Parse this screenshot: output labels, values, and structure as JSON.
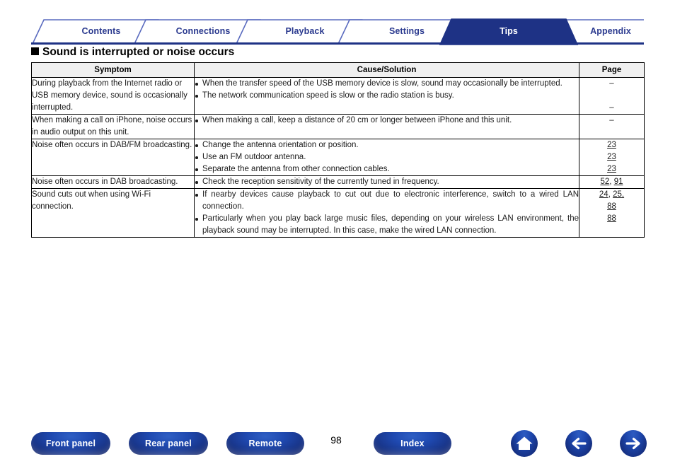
{
  "tabs": [
    {
      "label": "Contents",
      "active": false
    },
    {
      "label": "Connections",
      "active": false
    },
    {
      "label": "Playback",
      "active": false
    },
    {
      "label": "Settings",
      "active": false
    },
    {
      "label": "Tips",
      "active": true
    },
    {
      "label": "Appendix",
      "active": false
    }
  ],
  "heading": "Sound is interrupted or noise occurs",
  "table": {
    "headers": {
      "symptom": "Symptom",
      "cause": "Cause/Solution",
      "page": "Page"
    },
    "rows": [
      {
        "symptom": "During playback from the Internet radio or USB memory device, sound is occasionally interrupted.",
        "causes": [
          "When the transfer speed of the USB memory device is slow, sound may occasionally be interrupted.",
          "The network communication speed is slow or the radio station is busy."
        ],
        "pages": [
          [
            "–"
          ],
          [
            "–"
          ]
        ],
        "page_spacer": true
      },
      {
        "symptom": "When making a call on iPhone, noise occurs in audio output on this unit.",
        "causes": [
          "When making a call, keep a distance of 20 cm or longer between iPhone and this unit."
        ],
        "pages": [
          [
            "–"
          ]
        ]
      },
      {
        "symptom": "Noise often occurs in DAB/FM broadcasting.",
        "causes": [
          "Change the antenna orientation or position.",
          "Use an FM outdoor antenna.",
          "Separate the antenna from other connection cables."
        ],
        "pages": [
          [
            "23"
          ],
          [
            "23"
          ],
          [
            "23"
          ]
        ]
      },
      {
        "symptom": "Noise often occurs in DAB broadcasting.",
        "causes": [
          "Check the reception sensitivity of the currently tuned in frequency."
        ],
        "pages": [
          [
            "52",
            "91"
          ]
        ]
      },
      {
        "symptom": "Sound cuts out when using Wi-Fi connection.",
        "causes": [
          "If nearby devices cause playback to cut out due to electronic interference, switch to a wired LAN connection.",
          "Particularly when you play back large music files, depending on your wireless LAN environment, the playback sound may be interrupted. In this case, make the wired LAN connection."
        ],
        "pages": [
          [
            "24",
            "25,"
          ],
          [
            "88"
          ],
          [
            "88"
          ]
        ]
      }
    ]
  },
  "footer": {
    "buttons": [
      {
        "label": "Front panel"
      },
      {
        "label": "Rear panel"
      },
      {
        "label": "Remote"
      },
      {
        "label": "Index"
      }
    ],
    "page_number": "98",
    "icons": [
      {
        "name": "home-icon"
      },
      {
        "name": "arrow-left-icon"
      },
      {
        "name": "arrow-right-icon"
      }
    ]
  },
  "colors": {
    "brand_navy": "#1e3285",
    "tab_text": "#2b3a8f",
    "header_fill": "#f0f0f0"
  }
}
